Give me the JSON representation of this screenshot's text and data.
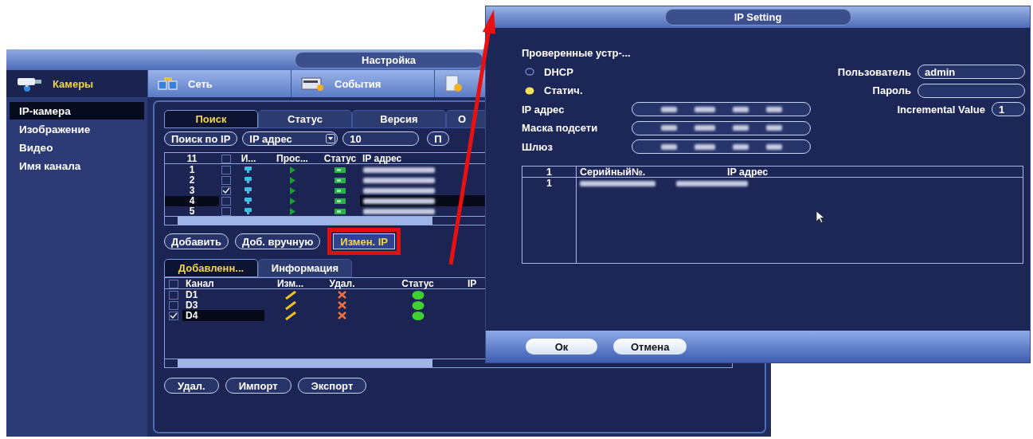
{
  "settings_window": {
    "title": "Настройка",
    "main_tabs": [
      {
        "kind": "camera",
        "label": "Камеры",
        "selected": true
      },
      {
        "kind": "network",
        "label": "Сеть",
        "selected": false
      },
      {
        "kind": "events",
        "label": "События",
        "selected": false
      },
      {
        "kind": "settings",
        "selected": false
      }
    ],
    "sidebar": {
      "items": [
        {
          "label": "IP-камера",
          "selected": true
        },
        {
          "label": "Изображение",
          "selected": false
        },
        {
          "label": "Видео",
          "selected": false
        },
        {
          "label": "Имя канала",
          "selected": false
        }
      ]
    },
    "search_tabs": [
      {
        "label": "Поиск",
        "selected": true
      },
      {
        "label": "Статус",
        "selected": false
      },
      {
        "label": "Версия",
        "selected": false
      },
      {
        "label": "О",
        "selected": false
      }
    ],
    "search_bar": {
      "search_button": "Поиск по IP",
      "filter": "IP адрес",
      "count": "10",
      "cut_button": "П"
    },
    "device_table": {
      "columns": [
        "11",
        "И...",
        "Прос...",
        "Статус",
        "IP адрес"
      ],
      "select_all": false,
      "rows": [
        {
          "number": "1",
          "checked": false,
          "selected": false
        },
        {
          "number": "2",
          "checked": false,
          "selected": false
        },
        {
          "number": "3",
          "checked": true,
          "selected": false
        },
        {
          "number": "4",
          "checked": false,
          "selected": true
        },
        {
          "number": "5",
          "checked": false,
          "selected": false
        }
      ]
    },
    "actions": [
      {
        "label": "Добавить",
        "highlighted": false
      },
      {
        "label": "Доб. вручную",
        "highlighted": false
      },
      {
        "label": "Измен. IP",
        "highlighted": true
      }
    ],
    "added_tabs": [
      {
        "label": "Добавленн...",
        "selected": true
      },
      {
        "label": "Информация",
        "selected": false
      }
    ],
    "added_table": {
      "columns": [
        "Канал",
        "Изм...",
        "Удал.",
        "Статус",
        "IP"
      ],
      "select_all": false,
      "rows": [
        {
          "channel": "D1",
          "checked": false,
          "selected": false
        },
        {
          "channel": "D3",
          "checked": false,
          "selected": false
        },
        {
          "channel": "D4",
          "checked": true,
          "selected": true
        }
      ]
    },
    "bottom_buttons": [
      "Удал.",
      "Импорт",
      "Экспорт"
    ]
  },
  "ip_dialog": {
    "title": "IP Setting",
    "section_label": "Проверенные устр-...",
    "modes": [
      {
        "label": "DHCP",
        "selected": false
      },
      {
        "label": "Статич.",
        "selected": true
      }
    ],
    "fields": [
      {
        "label": "IP адрес"
      },
      {
        "label": "Маска подсети"
      },
      {
        "label": "Шлюз"
      }
    ],
    "user": {
      "label": "Пользователь",
      "value": "admin"
    },
    "password": {
      "label": "Пароль"
    },
    "increment": {
      "label": "Incremental Value",
      "value": "1"
    },
    "table": {
      "columns": [
        "1",
        "Серийный№.",
        "IP адрес"
      ],
      "rows": [
        {
          "number": "1"
        }
      ]
    },
    "buttons": [
      "Ок",
      "Отмена"
    ]
  }
}
